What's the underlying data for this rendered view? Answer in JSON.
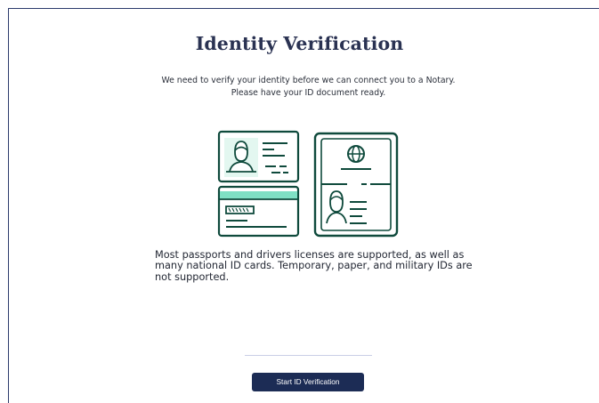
{
  "page": {
    "title": "Identity Verification",
    "intro_line1": "We need to verify your identity before we can connect you to a Notary.",
    "intro_line2": "Please have your ID document ready.",
    "support_text": "Most passports and drivers licenses are supported, as well as many national ID cards. Temporary, paper, and military IDs are not supported.",
    "start_button_label": "Start ID Verification"
  },
  "colors": {
    "frame_border": "#2b3a6b",
    "title": "#2a3252",
    "icon_stroke": "#0f4a3c",
    "icon_fill": "#7fe0c4",
    "icon_light": "#e3f7f0",
    "button_bg": "#1c2c55"
  },
  "illustration": {
    "icons": [
      "id-card-front-icon",
      "id-card-back-icon",
      "passport-icon",
      "globe-icon"
    ]
  }
}
